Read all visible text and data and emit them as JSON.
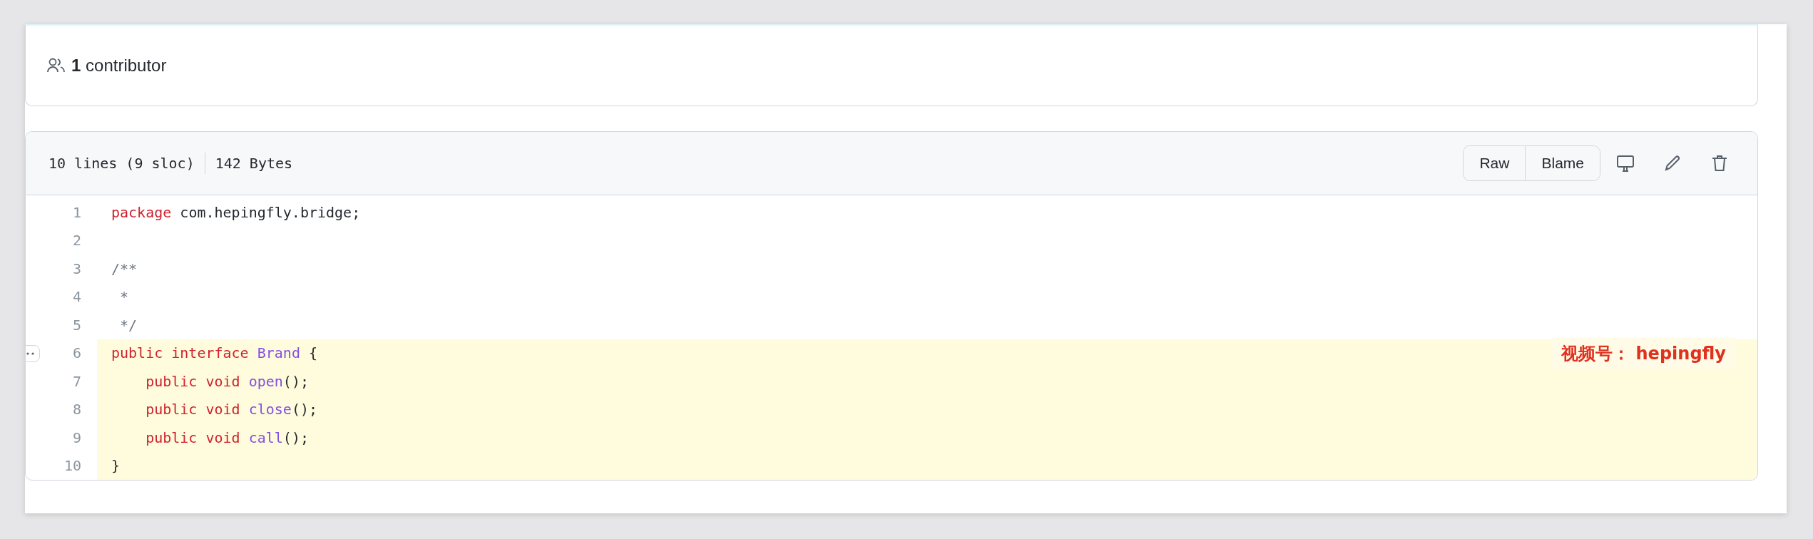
{
  "contributors": {
    "text": "**1** contributor"
  },
  "file": {
    "lines_info": "10 lines (9 sloc)",
    "size": "142 Bytes",
    "buttons": [
      "Raw",
      "Blame"
    ],
    "code": [
      {
        "number": "1",
        "highlighted": false,
        "tokens": [
          {
            "kind": "keyword",
            "text": "package"
          },
          {
            "kind": "plain",
            "text": " com.hepingfly.bridge;"
          }
        ]
      },
      {
        "number": "2",
        "highlighted": false
      },
      {
        "number": "3",
        "highlighted": false,
        "tokens": [
          {
            "kind": "comment",
            "text": "/**"
          }
        ]
      },
      {
        "number": "4",
        "highlighted": false,
        "tokens": [
          {
            "kind": "comment",
            "text": " *"
          }
        ]
      },
      {
        "number": "5",
        "highlighted": false,
        "tokens": [
          {
            "kind": "comment",
            "text": " */"
          }
        ]
      },
      {
        "number": "6",
        "highlighted": true,
        "tokens": [
          {
            "kind": "keyword",
            "text": "public"
          },
          {
            "kind": "keyword",
            "text": " interface"
          },
          {
            "kind": "entity",
            "text": " Brand"
          },
          {
            "kind": "plain",
            "text": " {"
          }
        ]
      },
      {
        "number": "7",
        "highlighted": true,
        "tokens": [
          {
            "kind": "keyword",
            "text": "    public void"
          },
          {
            "kind": "entity",
            "text": " open"
          },
          {
            "kind": "plain",
            "text": "();"
          }
        ]
      },
      {
        "number": "8",
        "highlighted": true,
        "tokens": [
          {
            "kind": "keyword",
            "text": "    public void"
          },
          {
            "kind": "entity",
            "text": " close"
          },
          {
            "kind": "plain",
            "text": "();"
          }
        ]
      },
      {
        "number": "9",
        "highlighted": true,
        "tokens": [
          {
            "kind": "keyword",
            "text": "    public void"
          },
          {
            "kind": "entity",
            "text": " call"
          },
          {
            "kind": "plain",
            "text": "();"
          }
        ]
      },
      {
        "number": "10",
        "highlighted": true,
        "tokens": [
          {
            "kind": "plain",
            "text": "}"
          }
        ]
      }
    ],
    "annotation": "视频号： hepingfly"
  }
}
